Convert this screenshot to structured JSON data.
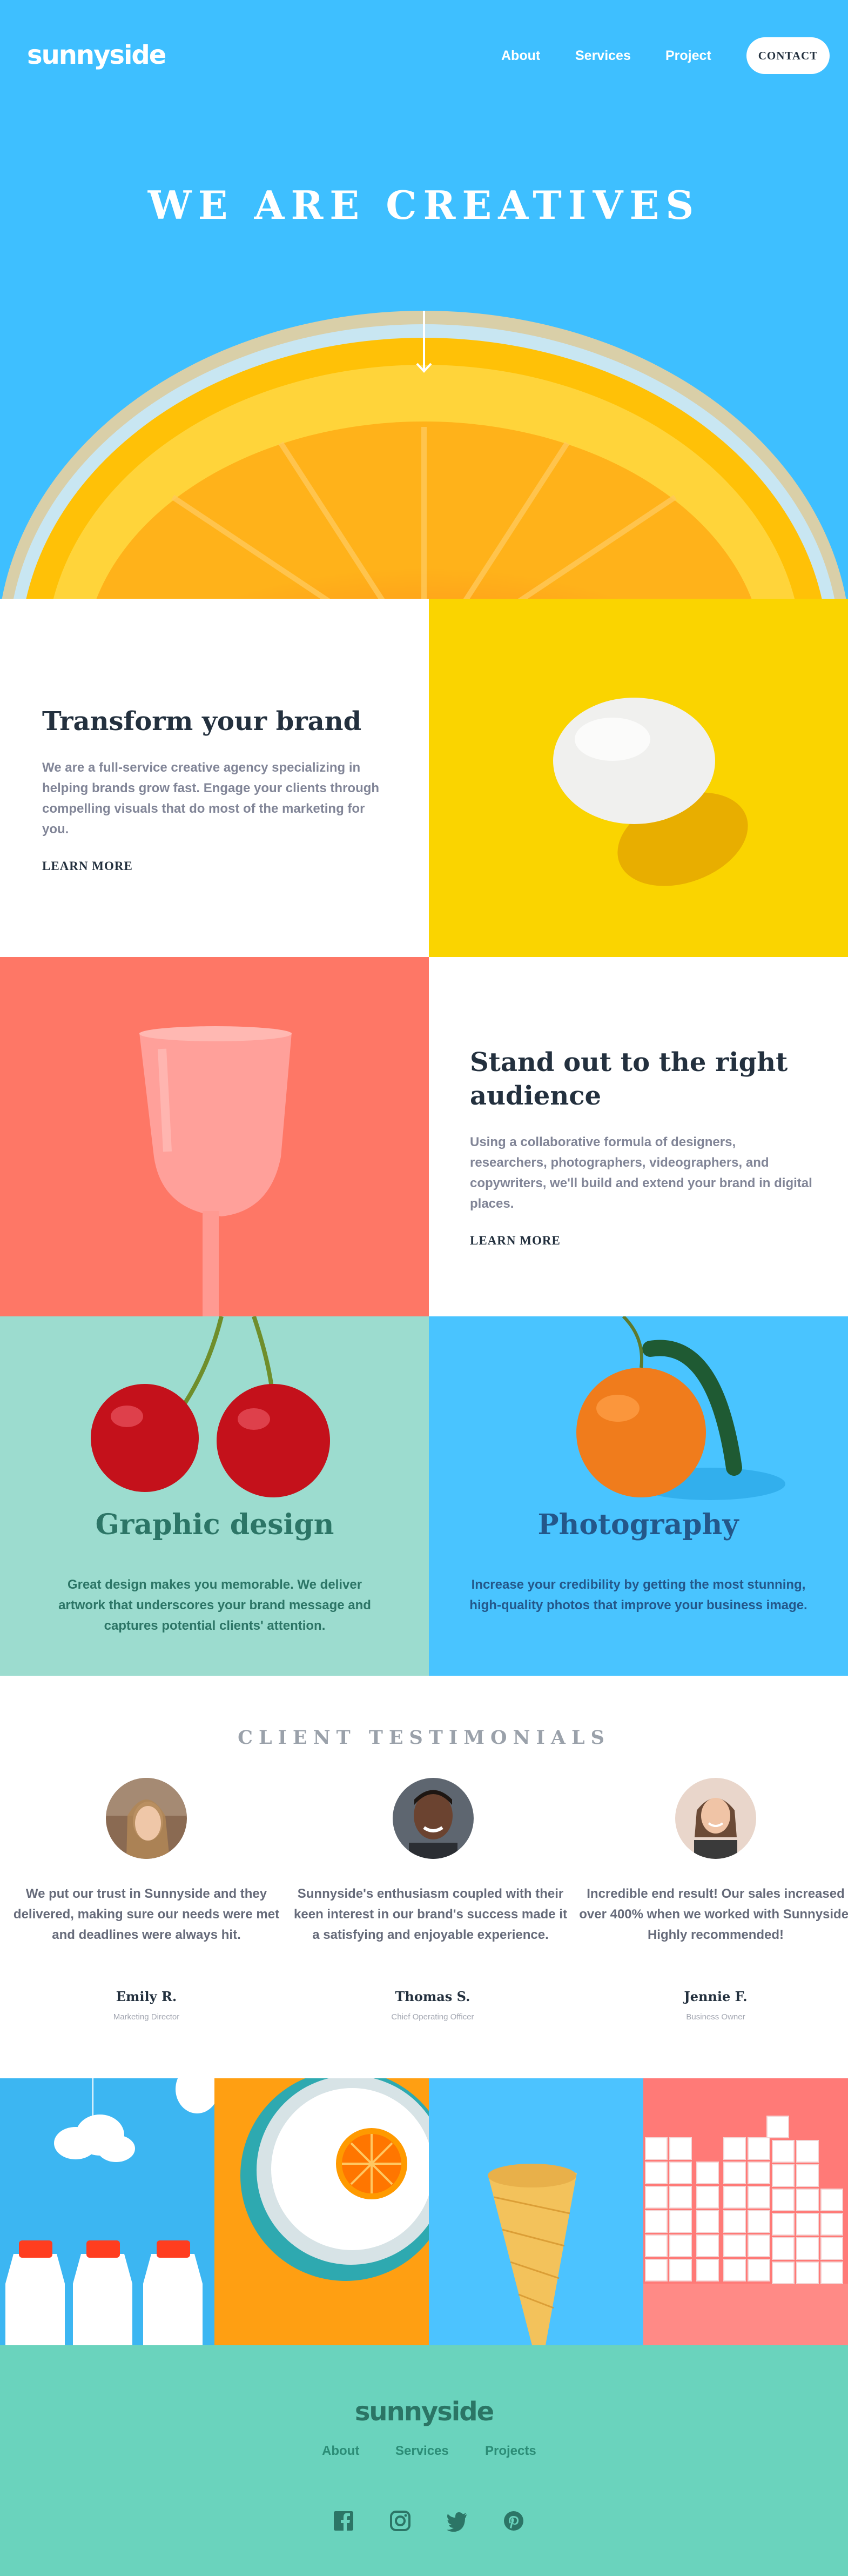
{
  "header": {
    "logo": "sunnyside",
    "nav": [
      {
        "label": "About"
      },
      {
        "label": "Services"
      },
      {
        "label": "Project"
      }
    ],
    "contact_label": "CONTACT"
  },
  "hero": {
    "title": "WE ARE CREATIVES",
    "arrow_icon": "arrow-down-icon"
  },
  "features": [
    {
      "heading": "Transform your brand",
      "body": "We are a full-service creative agency specializing in helping brands grow fast. Engage your clients through compelling visuals that do most of the marketing for you.",
      "link": "LEARN MORE",
      "accent": "#fad400"
    },
    {
      "heading": "Stand out to the right audience",
      "body": "Using a collaborative formula of designers, researchers, photographers, videographers, and copywriters, we'll build and extend your brand in digital places.",
      "link": "LEARN MORE",
      "accent": "#fe7766"
    }
  ],
  "services": [
    {
      "title": "Graphic design",
      "body": "Great design makes you memorable. We deliver artwork that underscores your brand message and captures potential clients' attention.",
      "title_color": "#2c7566",
      "body_color": "#2c7566"
    },
    {
      "title": "Photography",
      "body": "Increase your credibility by getting the most stunning, high-quality photos that improve your business image.",
      "title_color": "#24578a",
      "body_color": "#24578a"
    }
  ],
  "testimonials": {
    "label": "CLIENT TESTIMONIALS",
    "items": [
      {
        "quote": "We put our trust in Sunnyside and they delivered, making sure our needs were met and deadlines were always hit.",
        "name": "Emily R.",
        "role": "Marketing Director"
      },
      {
        "quote": "Sunnyside's enthusiasm coupled with their keen interest in our brand's success made it a satisfying and enjoyable experience.",
        "name": "Thomas S.",
        "role": "Chief Operating Officer"
      },
      {
        "quote": "Incredible end result! Our sales increased over 400% when we worked with Sunnyside. Highly recommended!",
        "name": "Jennie F.",
        "role": "Business Owner"
      }
    ]
  },
  "footer": {
    "logo": "sunnyside",
    "links": [
      {
        "label": "About"
      },
      {
        "label": "Services"
      },
      {
        "label": "Projects"
      }
    ],
    "social_icons": [
      "facebook-icon",
      "instagram-icon",
      "twitter-icon",
      "pinterest-icon"
    ]
  },
  "colors": {
    "hero_bg": "#3ebfff",
    "yellow": "#fad400",
    "salmon": "#fe7766",
    "mint": "#90d4c5",
    "footer_bg": "#6ad3bd",
    "dark_text": "#23303e"
  }
}
